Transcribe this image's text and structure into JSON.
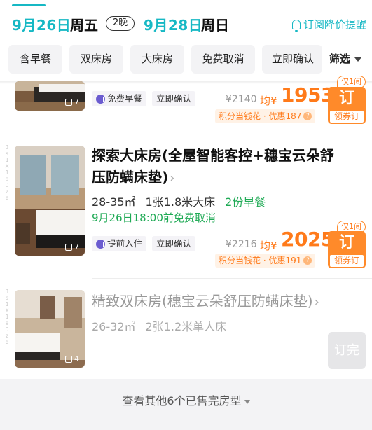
{
  "header": {
    "checkin_date": "9月26日",
    "checkin_weekday": "周五",
    "nights": "2晚",
    "checkout_date": "9月28日",
    "checkout_weekday": "周日",
    "subscribe_label": "订阅降价提醒"
  },
  "filters": {
    "chips": [
      "含早餐",
      "双床房",
      "大床房",
      "免费取消",
      "立即确认"
    ],
    "filter_label": "筛选"
  },
  "rooms": [
    {
      "photo_count": "7",
      "tags": [
        "免费早餐",
        "立即确认"
      ],
      "price_original": "¥2140",
      "price_prefix": "均¥",
      "price": "1953",
      "cash_label": "积分当钱花 · 优惠187",
      "book_label": "订",
      "book_sub": "领券订",
      "only_label": "仅1间"
    },
    {
      "name": "探索大床房(全屋智能客控+穗宝云朵舒压防螨床垫)",
      "area": "28-35㎡",
      "bed": "1张1.8米大床",
      "breakfast": "2份早餐",
      "cancel": "9月26日18:00前免费取消",
      "photo_count": "7",
      "tags": [
        "提前入住",
        "立即确认"
      ],
      "price_original": "¥2216",
      "price_prefix": "均¥",
      "price": "2025",
      "cash_label": "积分当钱花 · 优惠191",
      "book_label": "订",
      "book_sub": "领券订",
      "only_label": "仅1间",
      "watermark": "Js1X1aDze"
    },
    {
      "name": "精致双床房(穗宝云朵舒压防螨床垫)",
      "area": "26-32㎡",
      "bed": "2张1.2米单人床",
      "photo_count": "4",
      "book_label": "订完",
      "watermark": "Js1X1aDzq"
    }
  ],
  "more": {
    "label": "查看其他6个已售完房型"
  },
  "colors": {
    "accent": "#16b8c4",
    "price": "#ff7a1a",
    "green": "#1faa55"
  }
}
